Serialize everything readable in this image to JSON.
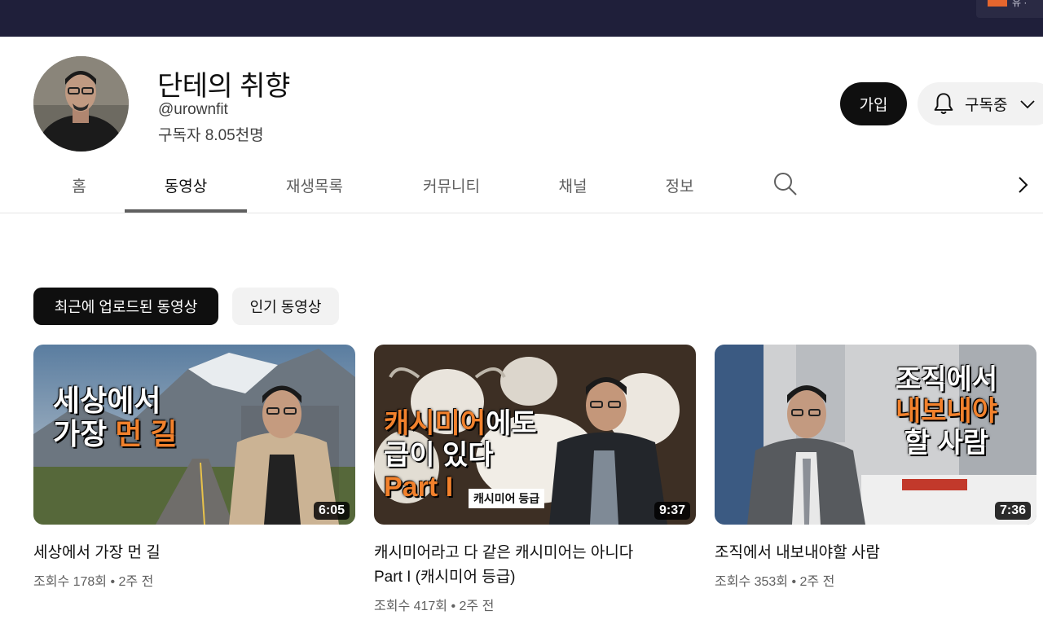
{
  "topbar": {
    "widget_text": "유 ·"
  },
  "channel": {
    "name": "단테의 취향",
    "handle": "@urownfit",
    "subscribers": "구독자 8.05천명",
    "join_label": "가입",
    "subscribed_label": "구독중"
  },
  "tabs": [
    {
      "label": "홈"
    },
    {
      "label": "동영상"
    },
    {
      "label": "재생목록"
    },
    {
      "label": "커뮤니티"
    },
    {
      "label": "채널"
    },
    {
      "label": "정보"
    }
  ],
  "active_tab": "동영상",
  "chips": [
    {
      "label": "최근에 업로드된 동영상"
    },
    {
      "label": "인기 동영상"
    }
  ],
  "videos": [
    {
      "thumb_lines": [
        "세상에서",
        "가장 ",
        "먼 길"
      ],
      "duration": "6:05",
      "title": "세상에서 가장 먼 길",
      "views": "조회수 178회",
      "age": "2주 전"
    },
    {
      "thumb_lines": [
        "캐시미어",
        "에도",
        "급이 있다",
        "Part I",
        "캐시미어 등급"
      ],
      "duration": "9:37",
      "title_line1": "캐시미어라고 다 같은 캐시미어는 아니다",
      "title_line2": "Part I (캐시미어 등급)",
      "views": "조회수 417회",
      "age": "2주 전"
    },
    {
      "thumb_lines": [
        "조직에서",
        "내보내야",
        "할 사람"
      ],
      "duration": "7:36",
      "title": "조직에서 내보내야할 사람",
      "views": "조회수 353회",
      "age": "2주 전"
    }
  ],
  "colors": {
    "topbar": "#1f1f3a",
    "accent_orange": "#e5662e",
    "thumb_highlight_orange": "#f2812c"
  }
}
